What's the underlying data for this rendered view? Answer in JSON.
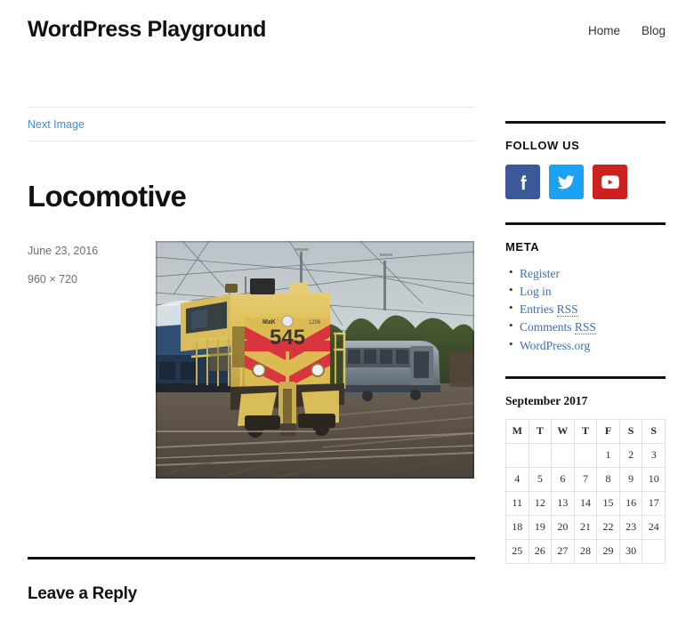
{
  "header": {
    "site_title": "WordPress Playground",
    "nav": [
      {
        "label": "Home"
      },
      {
        "label": "Blog"
      }
    ]
  },
  "image_nav": {
    "next_label": "Next Image"
  },
  "post": {
    "title": "Locomotive",
    "date": "June 23, 2016",
    "dimensions": "960 × 720",
    "image_alt": "Yellow MaK diesel locomotive number 545 with red chevron stripes on railway tracks"
  },
  "comments": {
    "title": "Leave a Reply"
  },
  "sidebar": {
    "follow": {
      "title": "Follow us",
      "icons": [
        {
          "name": "facebook-icon",
          "label": "Facebook",
          "color": "#3b5998"
        },
        {
          "name": "twitter-icon",
          "label": "Twitter",
          "color": "#1da1f2"
        },
        {
          "name": "youtube-icon",
          "label": "YouTube",
          "color": "#cd201f"
        }
      ]
    },
    "meta": {
      "title": "Meta",
      "items": [
        {
          "label": "Register",
          "abbr": ""
        },
        {
          "label": "Log in",
          "abbr": ""
        },
        {
          "label": "Entries ",
          "abbr": "RSS"
        },
        {
          "label": "Comments ",
          "abbr": "RSS"
        },
        {
          "label": "WordPress.org",
          "abbr": ""
        }
      ]
    },
    "calendar": {
      "caption": "September 2017",
      "day_headers": [
        "M",
        "T",
        "W",
        "T",
        "F",
        "S",
        "S"
      ],
      "weeks": [
        [
          "",
          "",
          "",
          "",
          "1",
          "2",
          "3"
        ],
        [
          "4",
          "5",
          "6",
          "7",
          "8",
          "9",
          "10"
        ],
        [
          "11",
          "12",
          "13",
          "14",
          "15",
          "16",
          "17"
        ],
        [
          "18",
          "19",
          "20",
          "21",
          "22",
          "23",
          "24"
        ],
        [
          "25",
          "26",
          "27",
          "28",
          "29",
          "30",
          ""
        ]
      ]
    }
  },
  "colors": {
    "link": "#3e8ed9",
    "meta_link": "#3e6fb5",
    "text": "#111111",
    "muted": "#6d6d6d",
    "rule": "#111111"
  }
}
